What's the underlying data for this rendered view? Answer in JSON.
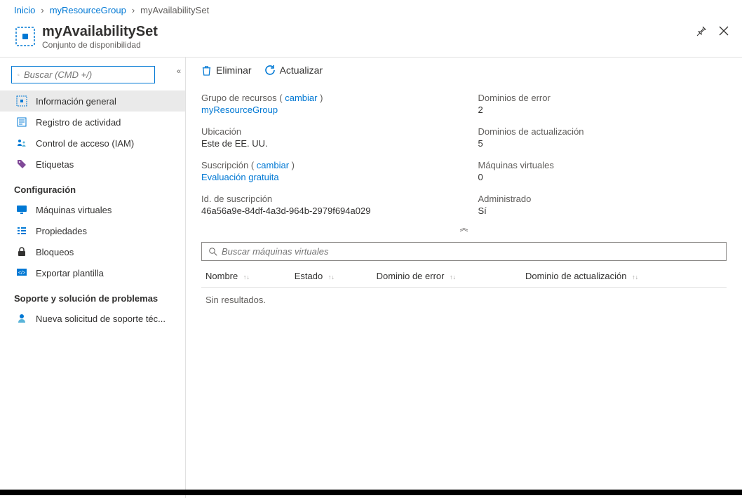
{
  "breadcrumb": {
    "items": [
      {
        "label": "Inicio",
        "link": true
      },
      {
        "label": "myResourceGroup",
        "link": true
      },
      {
        "label": "myAvailabilitySet",
        "link": false
      }
    ]
  },
  "header": {
    "title": "myAvailabilitySet",
    "subtitle": "Conjunto de disponibilidad"
  },
  "sidebar": {
    "search_placeholder": "Buscar (CMD +/)",
    "items_top": [
      {
        "label": "Información general",
        "icon": "availability-set-icon",
        "active": true
      },
      {
        "label": "Registro de actividad",
        "icon": "activity-log-icon"
      },
      {
        "label": "Control de acceso (IAM)",
        "icon": "access-control-icon"
      },
      {
        "label": "Etiquetas",
        "icon": "tags-icon"
      }
    ],
    "section_settings": "Configuración",
    "items_settings": [
      {
        "label": "Máquinas virtuales",
        "icon": "vm-icon"
      },
      {
        "label": "Propiedades",
        "icon": "properties-icon"
      },
      {
        "label": "Bloqueos",
        "icon": "lock-icon"
      },
      {
        "label": "Exportar plantilla",
        "icon": "export-template-icon"
      }
    ],
    "section_support": "Soporte y solución de problemas",
    "items_support": [
      {
        "label": "Nueva solicitud de soporte téc...",
        "icon": "support-icon"
      }
    ]
  },
  "toolbar": {
    "delete_label": "Eliminar",
    "refresh_label": "Actualizar"
  },
  "essentials": {
    "resource_group_label": "Grupo de recursos",
    "resource_group_change": "cambiar",
    "resource_group_value": "myResourceGroup",
    "location_label": "Ubicación",
    "location_value": "Este de EE. UU.",
    "subscription_label": "Suscripción",
    "subscription_change": "cambiar",
    "subscription_value": "Evaluación gratuita",
    "subscription_id_label": "Id. de suscripción",
    "subscription_id_value": "46a56a9e-84df-4a3d-964b-2979f694a029",
    "fault_domains_label": "Dominios de error",
    "fault_domains_value": "2",
    "update_domains_label": "Dominios de actualización",
    "update_domains_value": "5",
    "vms_label": "Máquinas virtuales",
    "vms_value": "0",
    "managed_label": "Administrado",
    "managed_value": "Sí"
  },
  "vm_search_placeholder": "Buscar máquinas virtuales",
  "vm_table": {
    "columns": [
      "Nombre",
      "Estado",
      "Dominio de error",
      "Dominio de actualización"
    ],
    "no_results": "Sin resultados."
  }
}
